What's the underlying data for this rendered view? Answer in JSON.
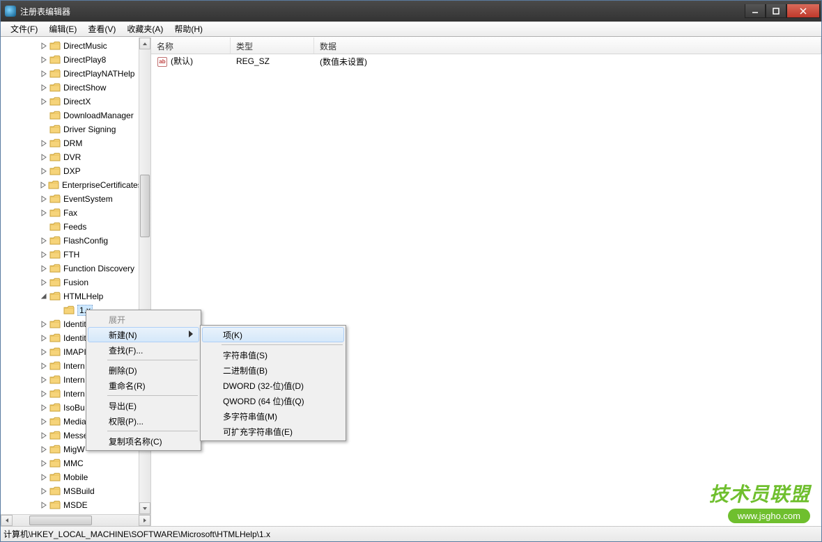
{
  "window": {
    "title": "注册表编辑器"
  },
  "menubar": [
    "文件(F)",
    "编辑(E)",
    "查看(V)",
    "收藏夹(A)",
    "帮助(H)"
  ],
  "tree": {
    "items": [
      {
        "label": "DirectMusic",
        "depth": 3,
        "exp": "closed"
      },
      {
        "label": "DirectPlay8",
        "depth": 3,
        "exp": "closed"
      },
      {
        "label": "DirectPlayNATHelp",
        "depth": 3,
        "exp": "closed"
      },
      {
        "label": "DirectShow",
        "depth": 3,
        "exp": "closed"
      },
      {
        "label": "DirectX",
        "depth": 3,
        "exp": "closed"
      },
      {
        "label": "DownloadManager",
        "depth": 3,
        "exp": "none"
      },
      {
        "label": "Driver Signing",
        "depth": 3,
        "exp": "none"
      },
      {
        "label": "DRM",
        "depth": 3,
        "exp": "closed"
      },
      {
        "label": "DVR",
        "depth": 3,
        "exp": "closed"
      },
      {
        "label": "DXP",
        "depth": 3,
        "exp": "closed"
      },
      {
        "label": "EnterpriseCertificates",
        "depth": 3,
        "exp": "closed"
      },
      {
        "label": "EventSystem",
        "depth": 3,
        "exp": "closed"
      },
      {
        "label": "Fax",
        "depth": 3,
        "exp": "closed"
      },
      {
        "label": "Feeds",
        "depth": 3,
        "exp": "none"
      },
      {
        "label": "FlashConfig",
        "depth": 3,
        "exp": "closed"
      },
      {
        "label": "FTH",
        "depth": 3,
        "exp": "closed"
      },
      {
        "label": "Function Discovery",
        "depth": 3,
        "exp": "closed"
      },
      {
        "label": "Fusion",
        "depth": 3,
        "exp": "closed"
      },
      {
        "label": "HTMLHelp",
        "depth": 3,
        "exp": "open"
      },
      {
        "label": "1.x",
        "depth": 4,
        "exp": "none",
        "selected": true
      },
      {
        "label": "Identit",
        "depth": 3,
        "exp": "closed"
      },
      {
        "label": "Identit",
        "depth": 3,
        "exp": "closed"
      },
      {
        "label": "IMAPI",
        "depth": 3,
        "exp": "closed"
      },
      {
        "label": "Intern",
        "depth": 3,
        "exp": "closed"
      },
      {
        "label": "Intern",
        "depth": 3,
        "exp": "closed"
      },
      {
        "label": "Intern",
        "depth": 3,
        "exp": "closed"
      },
      {
        "label": "IsoBu",
        "depth": 3,
        "exp": "closed"
      },
      {
        "label": "Media",
        "depth": 3,
        "exp": "closed"
      },
      {
        "label": "Messe",
        "depth": 3,
        "exp": "closed"
      },
      {
        "label": "MigW",
        "depth": 3,
        "exp": "closed"
      },
      {
        "label": "MMC",
        "depth": 3,
        "exp": "closed"
      },
      {
        "label": "Mobile",
        "depth": 3,
        "exp": "closed"
      },
      {
        "label": "MSBuild",
        "depth": 3,
        "exp": "closed"
      },
      {
        "label": "MSDE",
        "depth": 3,
        "exp": "closed"
      }
    ]
  },
  "list": {
    "columns": {
      "name": "名称",
      "type": "类型",
      "data": "数据"
    },
    "rows": [
      {
        "icon": "ab",
        "name": "(默认)",
        "type": "REG_SZ",
        "data": "(数值未设置)"
      }
    ]
  },
  "context_menu": {
    "items": [
      {
        "label": "展开",
        "disabled": true
      },
      {
        "label": "新建(N)",
        "submenu": true,
        "hover": true
      },
      {
        "label": "查找(F)..."
      },
      {
        "sep": true
      },
      {
        "label": "删除(D)"
      },
      {
        "label": "重命名(R)"
      },
      {
        "sep": true
      },
      {
        "label": "导出(E)"
      },
      {
        "label": "权限(P)..."
      },
      {
        "sep": true
      },
      {
        "label": "复制项名称(C)"
      }
    ]
  },
  "submenu": {
    "items": [
      {
        "label": "项(K)",
        "hover": true
      },
      {
        "sep": true
      },
      {
        "label": "字符串值(S)"
      },
      {
        "label": "二进制值(B)"
      },
      {
        "label": "DWORD (32-位)值(D)"
      },
      {
        "label": "QWORD (64 位)值(Q)"
      },
      {
        "label": "多字符串值(M)"
      },
      {
        "label": "可扩充字符串值(E)"
      }
    ]
  },
  "statusbar": {
    "path": "计算机\\HKEY_LOCAL_MACHINE\\SOFTWARE\\Microsoft\\HTMLHelp\\1.x"
  },
  "watermark": {
    "big": "技术员联盟",
    "url": "www.jsgho.com"
  }
}
